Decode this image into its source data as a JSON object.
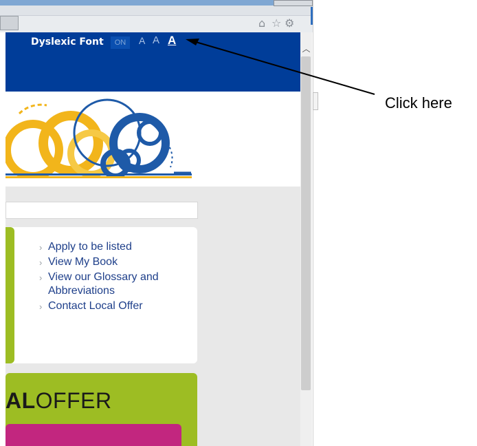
{
  "header": {
    "dyslexic_label": "Dyslexic Font",
    "dyslexic_state": "ON",
    "text_size_small": "A",
    "text_size_medium": "A",
    "text_size_large": "A"
  },
  "links": [
    {
      "label": "Apply to be listed"
    },
    {
      "label": "View My Book"
    },
    {
      "label": "View our Glossary and Abbreviations"
    },
    {
      "label": "Contact Local Offer"
    }
  ],
  "offer_banner": {
    "bold_part": "AL",
    "rest": "OFFER"
  },
  "annotation": {
    "text": "Click here"
  },
  "colors": {
    "header_blue": "#003d99",
    "brand_green": "#9dbd23",
    "brand_pink": "#c2267f",
    "link_blue": "#1e3f8a",
    "logo_yellow": "#f2b51b",
    "logo_blue": "#1e5aa8"
  },
  "icons": [
    "home-icon",
    "star-icon",
    "gear-icon",
    "scroll-up-arrow-icon"
  ]
}
